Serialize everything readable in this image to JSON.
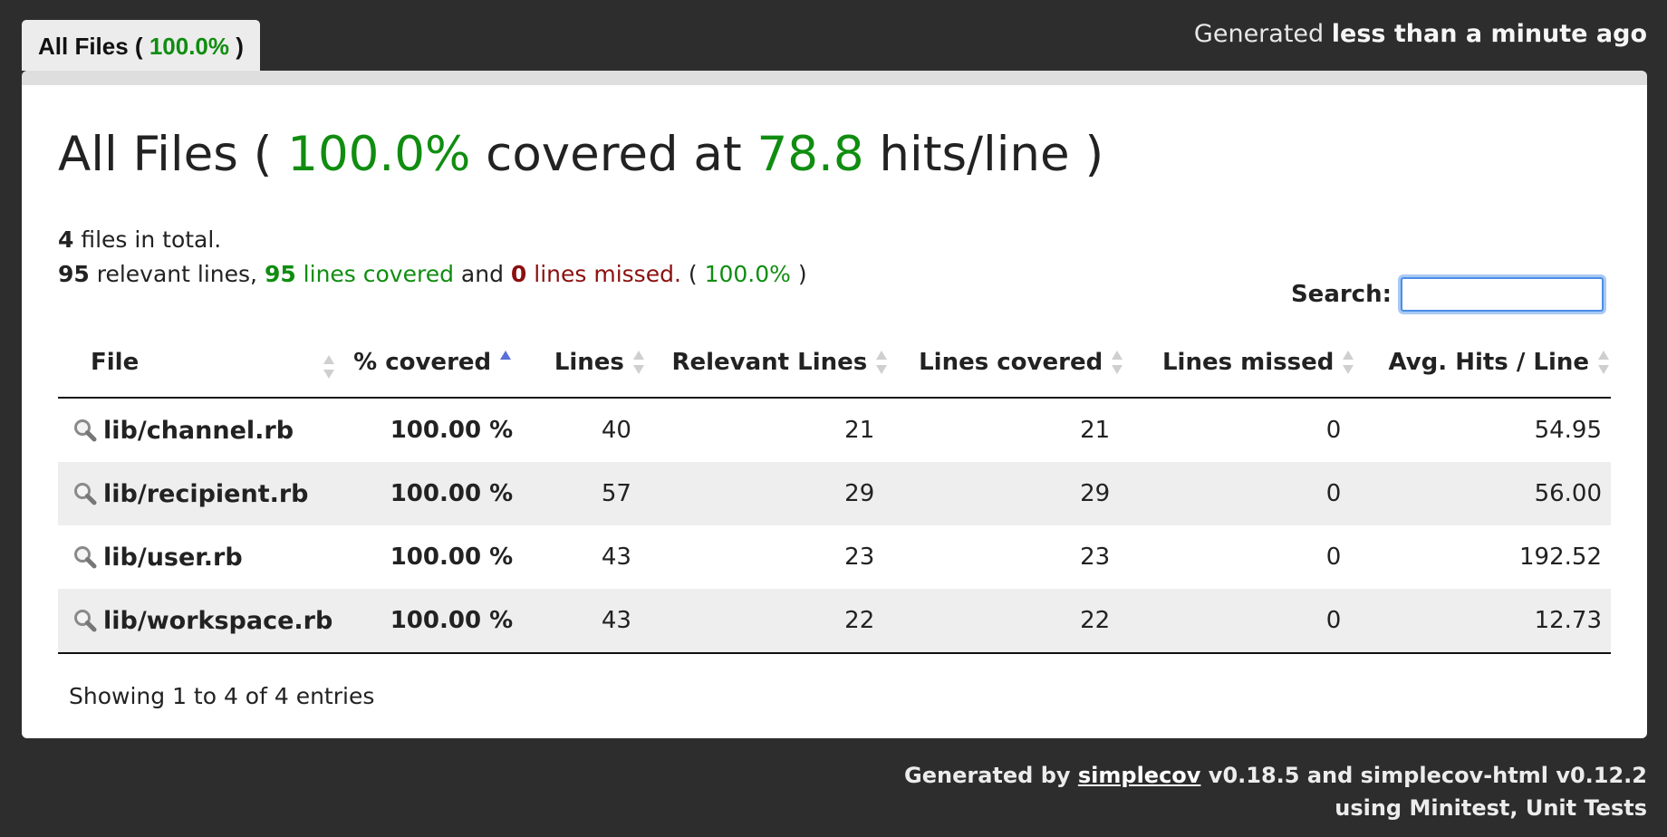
{
  "tab": {
    "label_prefix": "All Files ( ",
    "percent": "100.0%",
    "label_suffix": " )"
  },
  "timestamp": {
    "prefix": "Generated ",
    "value": "less than a minute ago"
  },
  "title": {
    "prefix": "All Files ( ",
    "percent": "100.0%",
    "middle": " covered at ",
    "hits": "78.8",
    "suffix": " hits/line )"
  },
  "summary": {
    "files_count": "4",
    "files_text": " files in total.",
    "relevant_count": "95",
    "relevant_text": " relevant lines, ",
    "covered_count": "95",
    "covered_text": " lines covered",
    "and_text": " and ",
    "missed_count": "0",
    "missed_text": " lines missed.",
    "percent_open": " ( ",
    "percent": "100.0%",
    "percent_close": " )"
  },
  "search": {
    "label": "Search:",
    "value": "",
    "placeholder": ""
  },
  "table": {
    "headers": [
      "File",
      "% covered",
      "Lines",
      "Relevant Lines",
      "Lines covered",
      "Lines missed",
      "Avg. Hits / Line"
    ],
    "rows": [
      {
        "file": "lib/channel.rb",
        "covered": "100.00 %",
        "lines": "40",
        "relevant": "21",
        "lines_covered": "21",
        "missed": "0",
        "avg_hits": "54.95"
      },
      {
        "file": "lib/recipient.rb",
        "covered": "100.00 %",
        "lines": "57",
        "relevant": "29",
        "lines_covered": "29",
        "missed": "0",
        "avg_hits": "56.00"
      },
      {
        "file": "lib/user.rb",
        "covered": "100.00 %",
        "lines": "43",
        "relevant": "23",
        "lines_covered": "23",
        "missed": "0",
        "avg_hits": "192.52"
      },
      {
        "file": "lib/workspace.rb",
        "covered": "100.00 %",
        "lines": "43",
        "relevant": "22",
        "lines_covered": "22",
        "missed": "0",
        "avg_hits": "12.73"
      }
    ]
  },
  "entries": "Showing 1 to 4 of 4 entries",
  "footer": {
    "generated_by": "Generated by ",
    "link": "simplecov",
    "versions": " v0.18.5 and simplecov-html v0.12.2",
    "line2": "using Minitest, Unit Tests"
  },
  "colors": {
    "covered_green": "#108d10",
    "missed_red": "#8b0f0f",
    "background": "#2d2d2d",
    "row_alt": "#eeeeee"
  }
}
